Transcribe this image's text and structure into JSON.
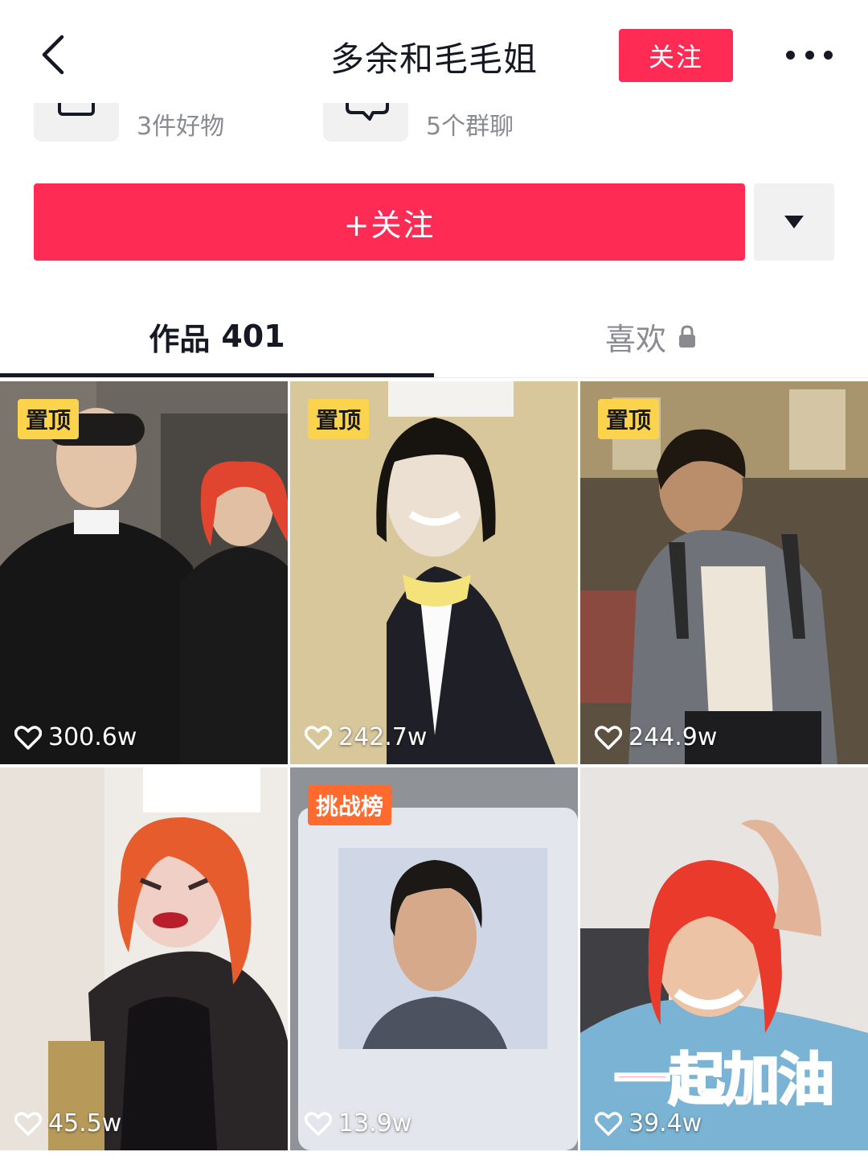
{
  "header": {
    "title": "多余和毛毛姐",
    "follow_label": "关注"
  },
  "shortcuts": [
    {
      "label": "3件好物",
      "icon": "shop-icon"
    },
    {
      "label": "5个群聊",
      "icon": "chat-icon"
    }
  ],
  "follow_main_label": "+关注",
  "tabs": {
    "works_label": "作品",
    "works_count": "401",
    "likes_label": "喜欢"
  },
  "videos": [
    {
      "badge": "置顶",
      "likes": "300.6w"
    },
    {
      "badge": "置顶",
      "likes": "242.7w"
    },
    {
      "badge": "置顶",
      "likes": "244.9w"
    },
    {
      "badge": "",
      "likes": "45.5w"
    },
    {
      "badge": "挑战榜",
      "likes": "13.9w"
    },
    {
      "badge": "",
      "likes": "39.4w",
      "overlay_text": "一起加油"
    }
  ],
  "colors": {
    "brand_red": "#fe2c55",
    "pin_badge": "#fcd34d",
    "challenge_badge": "#ff6a2f",
    "muted_text": "#8a8b91"
  }
}
